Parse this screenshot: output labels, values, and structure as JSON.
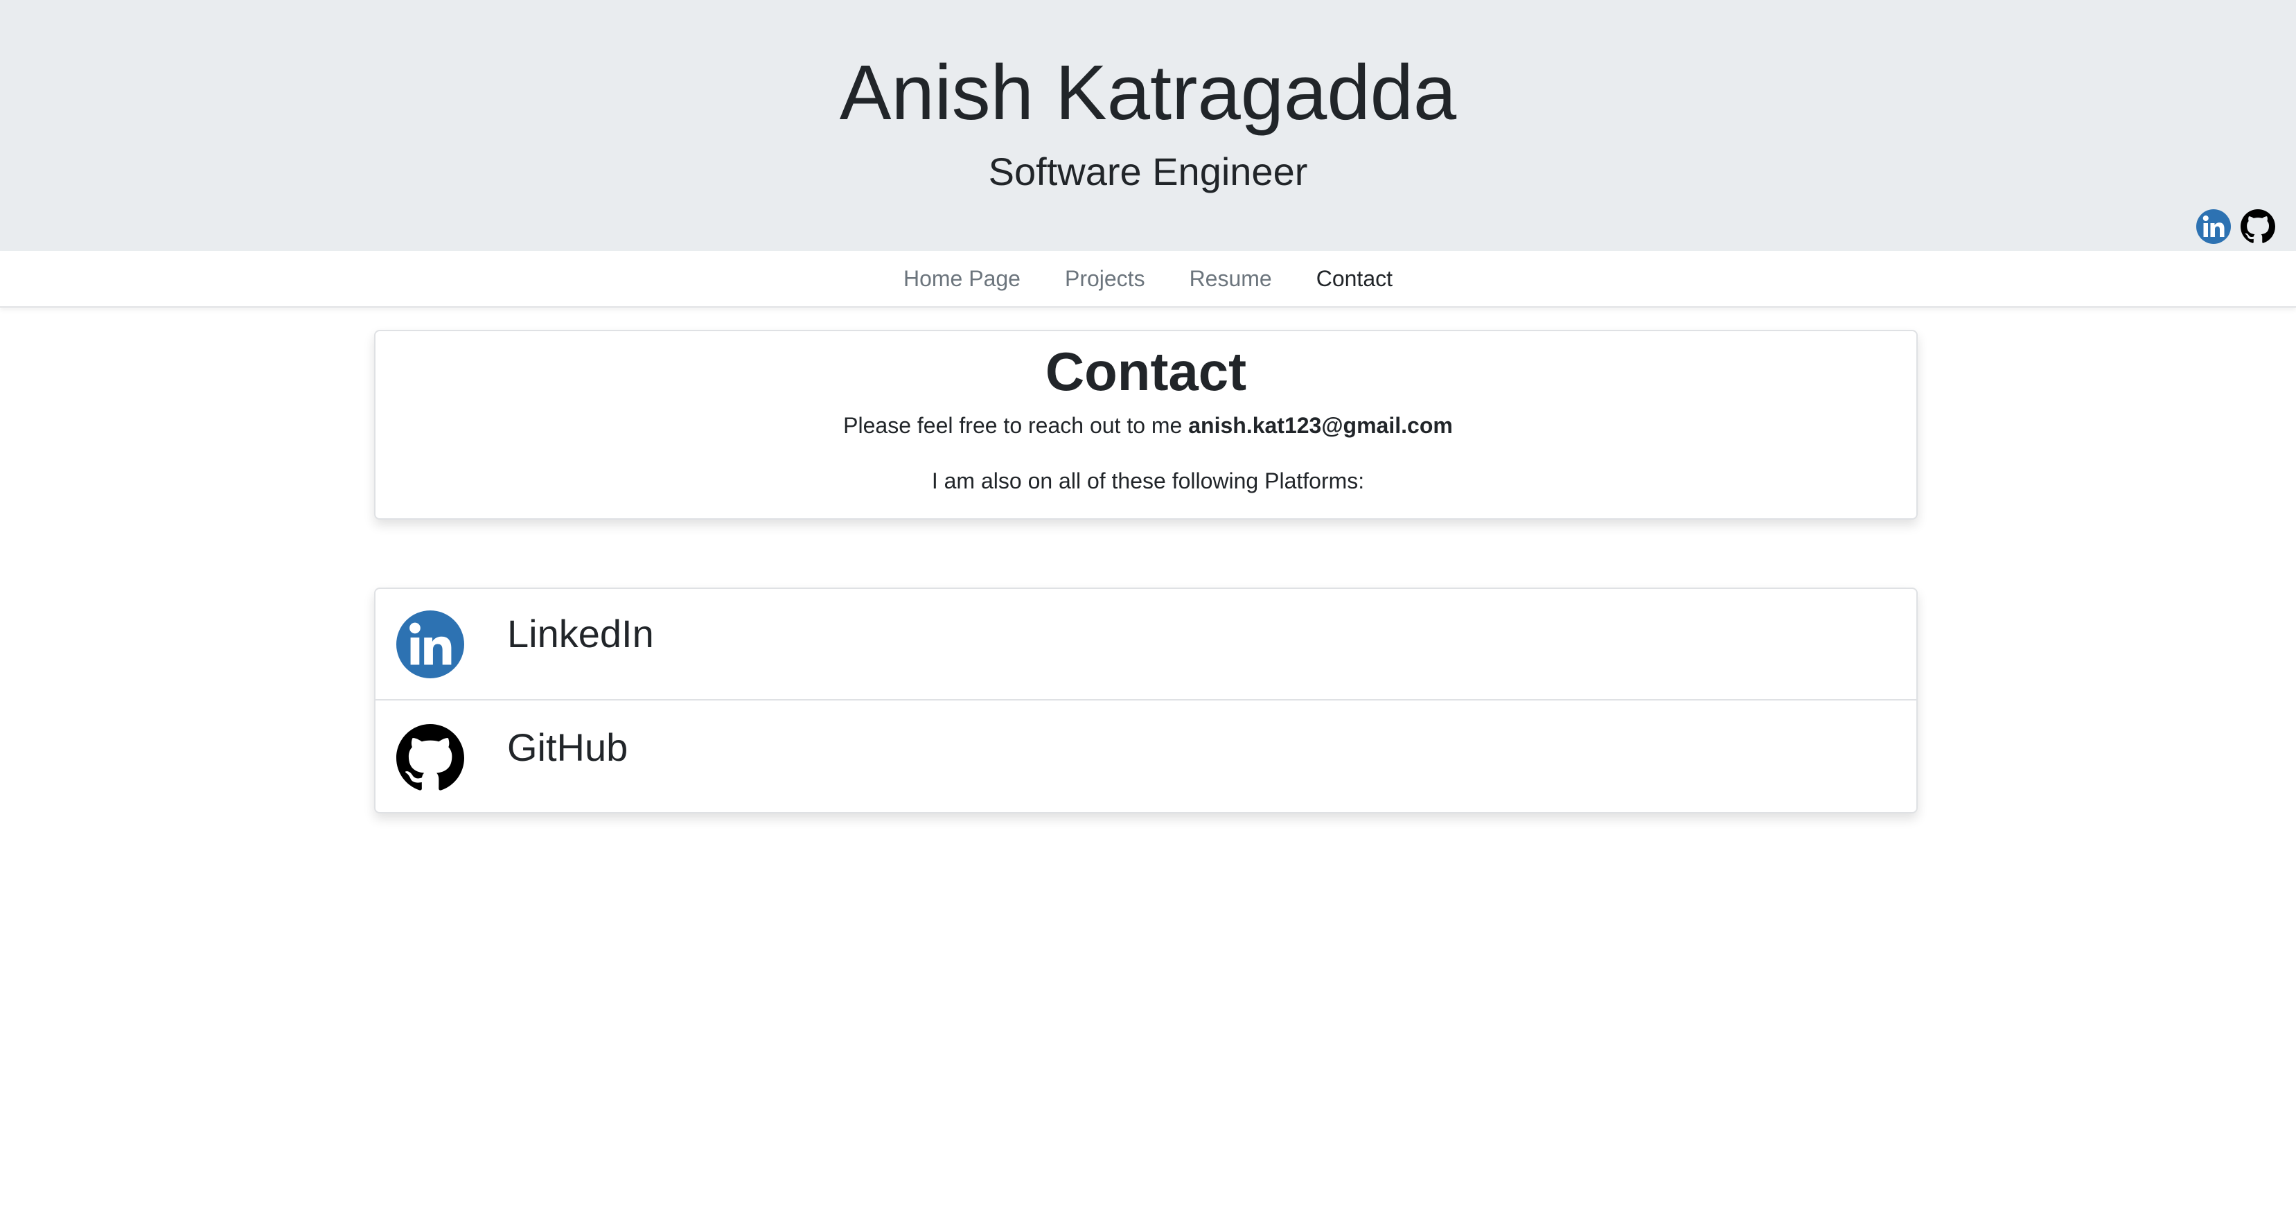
{
  "header": {
    "name": "Anish Katragadda",
    "subtitle": "Software Engineer",
    "social_icons": [
      {
        "icon": "linkedin-icon",
        "color": "#2d72b2"
      },
      {
        "icon": "github-icon",
        "color": "#000000"
      }
    ]
  },
  "nav": {
    "items": [
      {
        "label": "Home Page",
        "active": false
      },
      {
        "label": "Projects",
        "active": false
      },
      {
        "label": "Resume",
        "active": false
      },
      {
        "label": "Contact",
        "active": true
      }
    ]
  },
  "contact": {
    "title": "Contact",
    "line1_prefix": "Please feel free to reach out to me ",
    "email": "anish.kat123@gmail.com",
    "line2": "I am also on all of these following Platforms:"
  },
  "platforms": [
    {
      "label": "LinkedIn",
      "icon": "linkedin-icon"
    },
    {
      "label": "GitHub",
      "icon": "github-icon"
    }
  ],
  "colors": {
    "hero_background": "#e9ecef",
    "linkedin_blue": "#2d72b2",
    "text": "#212529",
    "nav_muted": "#6c757d"
  }
}
